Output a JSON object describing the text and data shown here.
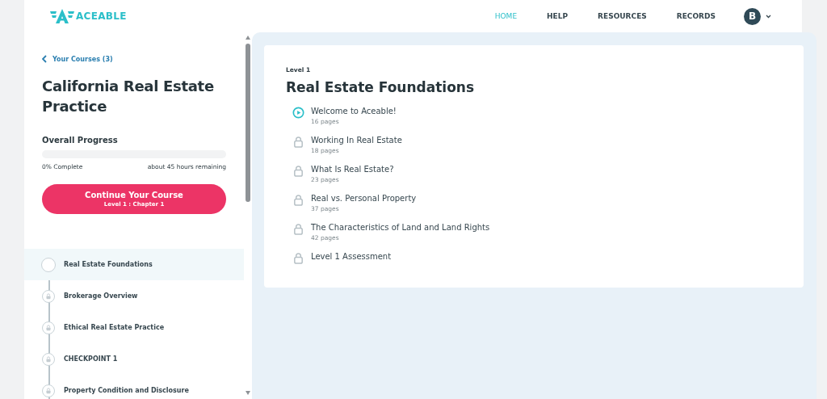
{
  "header": {
    "logo_text": "ACEABLE",
    "nav": [
      {
        "label": "HOME",
        "selected": true
      },
      {
        "label": "HELP",
        "selected": false
      },
      {
        "label": "RESOURCES",
        "selected": false
      },
      {
        "label": "RECORDS",
        "selected": false
      }
    ],
    "avatar": "B"
  },
  "sidebar": {
    "back_link": "Your Courses (3)",
    "course_title": "California Real Estate Practice",
    "progress_label": "Overall Progress",
    "level": 0,
    "complete": "0% Complete",
    "remaining": "about 45 hours remaining",
    "continue_button": {
      "label": "Continue Your Course",
      "sub": "Level 1 : Chapter 1"
    },
    "items": [
      {
        "label": "Real Estate Foundations",
        "kind": "current",
        "selected": true
      },
      {
        "label": "Brokerage Overview",
        "kind": "locked",
        "selected": false
      },
      {
        "label": "Ethical Real Estate Practice",
        "kind": "locked",
        "selected": false
      },
      {
        "label": "CHECKPOINT 1",
        "kind": "locked",
        "selected": false
      },
      {
        "label": "Property Condition and Disclosure",
        "kind": "locked",
        "selected": false
      }
    ]
  },
  "main": {
    "eyebrow": "Level 1",
    "title": "Real Estate Foundations",
    "lessons": [
      {
        "title": "Welcome to Aceable!",
        "pages": "16 pages",
        "kind": "play"
      },
      {
        "title": "Working In Real Estate",
        "pages": "18 pages",
        "kind": "locked"
      },
      {
        "title": "What Is Real Estate?",
        "pages": "23 pages",
        "kind": "locked"
      },
      {
        "title": "Real vs. Personal Property",
        "pages": "37 pages",
        "kind": "locked"
      },
      {
        "title": "The Characteristics of Land and Land Rights",
        "pages": "42 pages",
        "kind": "locked"
      },
      {
        "title": "Level 1 Assessment",
        "kind": "locked"
      }
    ]
  }
}
